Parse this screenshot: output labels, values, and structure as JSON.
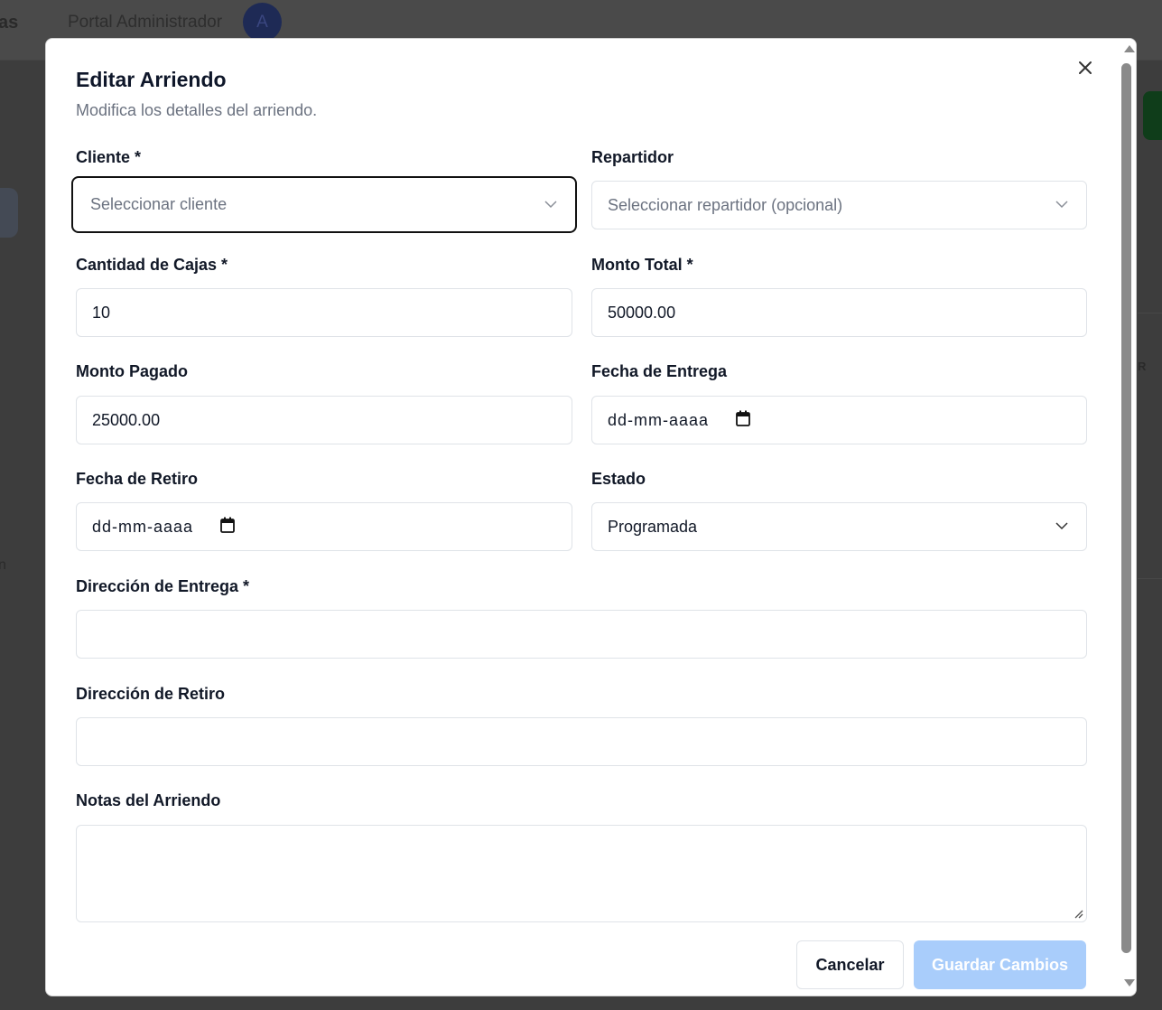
{
  "background": {
    "brand_fragment": "as",
    "portal_title": "Portal Administrador",
    "avatar_initial": "A",
    "column_fragment": "R",
    "row_fragment": "n"
  },
  "modal": {
    "title": "Editar Arriendo",
    "subtitle": "Modifica los detalles del arriendo.",
    "fields": {
      "cliente": {
        "label": "Cliente *",
        "placeholder": "Seleccionar cliente"
      },
      "repartidor": {
        "label": "Repartidor",
        "placeholder": "Seleccionar repartidor (opcional)"
      },
      "cantidad_cajas": {
        "label": "Cantidad de Cajas *",
        "value": "10"
      },
      "monto_total": {
        "label": "Monto Total *",
        "value": "50000.00"
      },
      "monto_pagado": {
        "label": "Monto Pagado",
        "value": "25000.00"
      },
      "fecha_entrega": {
        "label": "Fecha de Entrega",
        "placeholder": "dd-mm-aaaa"
      },
      "fecha_retiro": {
        "label": "Fecha de Retiro",
        "placeholder": "dd-mm-aaaa"
      },
      "estado": {
        "label": "Estado",
        "value": "Programada"
      },
      "direccion_entrega": {
        "label": "Dirección de Entrega *",
        "value": ""
      },
      "direccion_retiro": {
        "label": "Dirección de Retiro",
        "value": ""
      },
      "notas": {
        "label": "Notas del Arriendo",
        "value": ""
      }
    },
    "buttons": {
      "cancel": "Cancelar",
      "save": "Guardar Cambios"
    }
  },
  "icons": {
    "close": "close-icon",
    "dropdown": "chevron-down-icon",
    "calendar": "calendar-icon"
  },
  "colors": {
    "save_button_disabled": "#a9cdfb",
    "focus_border": "#111111",
    "avatar": "#1e2a55"
  }
}
